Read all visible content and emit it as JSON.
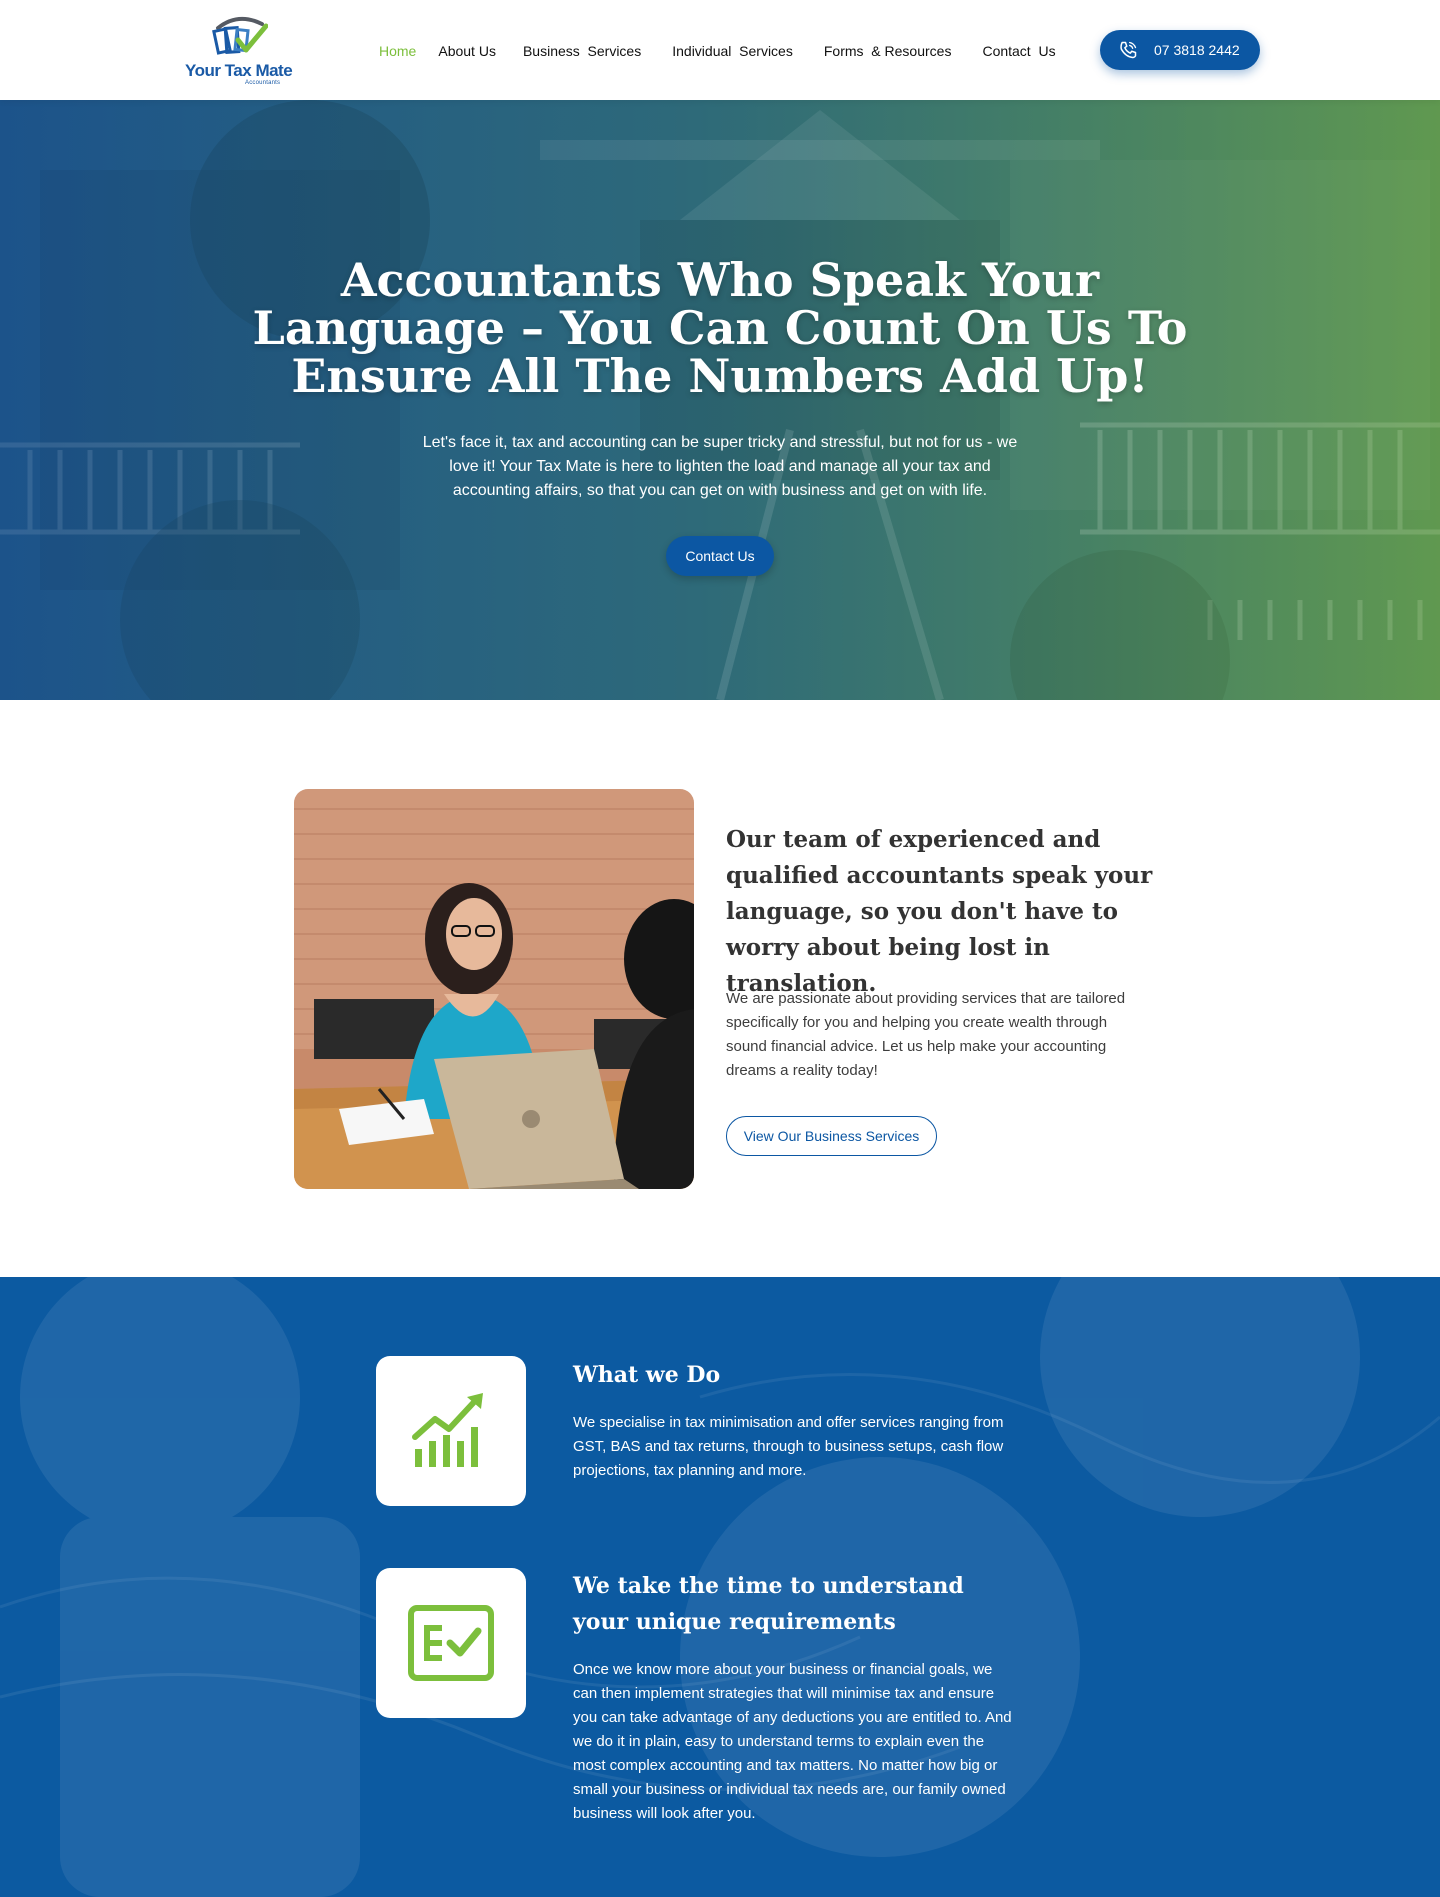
{
  "brand": {
    "name": "Your Tax Mate",
    "tagline": "Accountants",
    "colors": {
      "primary_blue": "#0c57a3",
      "accent_green": "#7cbf3c",
      "text_dark": "#333333"
    }
  },
  "nav": {
    "items": [
      {
        "label": "Home",
        "active": true
      },
      {
        "label": "About Us",
        "active": false
      },
      {
        "label": "Business  Services",
        "active": false
      },
      {
        "label": "Individual  Services",
        "active": false
      },
      {
        "label": "Forms  & Resources",
        "active": false
      },
      {
        "label": "Contact  Us",
        "active": false
      }
    ],
    "phone": {
      "icon": "phone-icon",
      "label": "07 3818 2442"
    }
  },
  "hero": {
    "title": "Accountants Who Speak Your Language – You Can Count On Us To Ensure All The Numbers Add Up!",
    "text": "Let's face it, tax and accounting can be super tricky and stressful, but not for us - we love it! Your Tax Mate is here to lighten the load and manage all your tax and accounting affairs, so that you can get on with business and get on with life.",
    "button": "Contact Us"
  },
  "intro": {
    "heading": "Our team of experienced and qualified accountants speak your language, so you don't have to worry about being lost in translation.",
    "text": "We are passionate about providing services that are tailored specifically for you and helping you create wealth through sound financial advice. Let us help make your accounting dreams a reality today!",
    "button": "View Our Business Services"
  },
  "features": [
    {
      "icon": "growth-chart-icon",
      "title": "What we Do",
      "text": "We specialise in tax minimisation and offer services ranging from GST, BAS and tax returns, through to business setups, cash flow projections, tax planning and more."
    },
    {
      "icon": "checklist-icon",
      "title": "We take the time to understand your unique requirements",
      "text": "Once we know more about your business or financial goals, we can then implement strategies that will minimise tax and ensure you can take advantage of any deductions you are entitled to. And we do it in plain, easy to understand terms to explain even the most complex accounting and tax matters. No matter how big or small your business or individual tax needs are, our family owned business will look after you."
    }
  ]
}
